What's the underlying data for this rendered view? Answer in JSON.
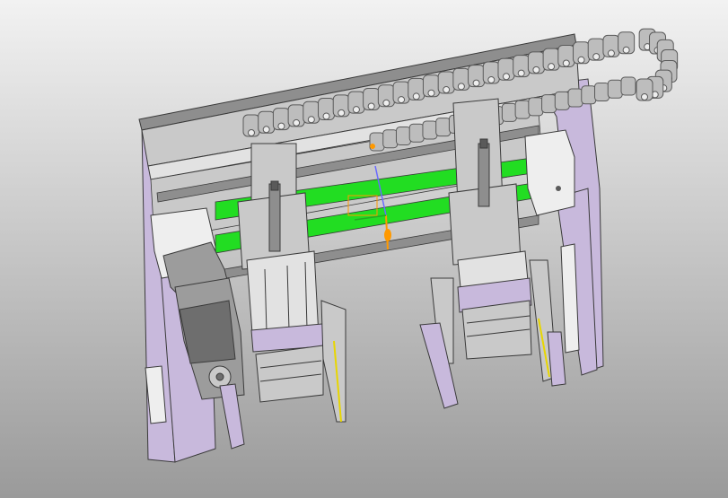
{
  "viewport": {
    "background_top": "#f2f2f2",
    "background_bottom": "#9a9a9a"
  },
  "colors": {
    "frame": "#c8b9dc",
    "frame_edge": "#3a3a3a",
    "metal": "#c9c9c9",
    "metal_dark": "#8e8e8e",
    "metal_light": "#e2e2e2",
    "rail_green": "#22dd22",
    "chain": "#bdbdbd",
    "chain_dark": "#5a5a5a",
    "motor": "#9c9c9c",
    "motor_dark": "#6e6e6e",
    "block_white": "#eeeeee",
    "sensor_yellow": "#e8d600",
    "triad_orange": "#ff9900",
    "triad_green": "#22aa22",
    "triad_blue": "#6a6aff"
  },
  "icons": {
    "coordinate_triad": "coordinate-triad-icon"
  }
}
